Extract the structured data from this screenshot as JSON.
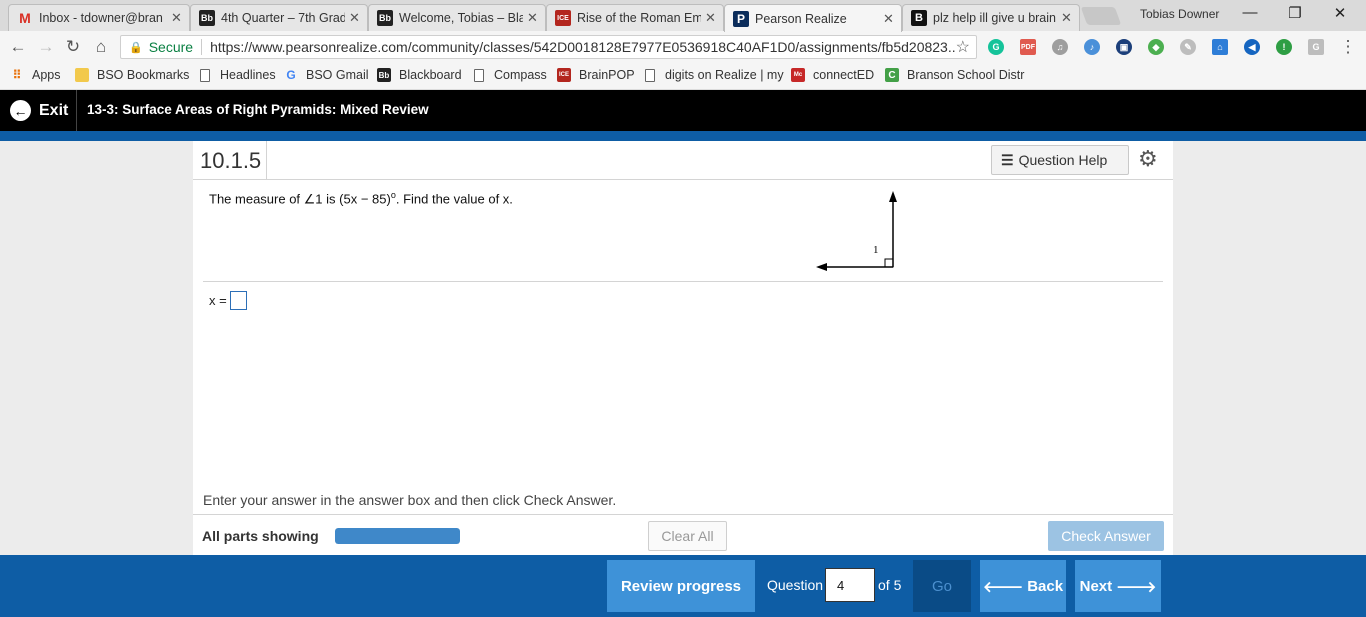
{
  "tabs": [
    {
      "title": "Inbox - tdowner@bran",
      "favicon": "M",
      "color": "#ffffff"
    },
    {
      "title": "4th Quarter – 7th Grad",
      "favicon": "Bb",
      "color": "#222222"
    },
    {
      "title": "Welcome, Tobias – Bla",
      "favicon": "Bb",
      "color": "#222222"
    },
    {
      "title": "Rise of the Roman Em",
      "favicon": "ICE",
      "color": "#b3261e"
    },
    {
      "title": "Pearson Realize",
      "favicon": "P",
      "color": "#0b2d5b"
    },
    {
      "title": "plz help ill give u brain",
      "favicon": "B",
      "color": "#111111"
    }
  ],
  "profile_name": "Tobias Downer",
  "window_controls": {
    "minimize": "—",
    "restore": "❐",
    "close": "✕"
  },
  "address": {
    "secure_label": "Secure",
    "url": "https://www.pearsonrealize.com/community/classes/542D0018128E7977E0536918C40AF1D0/assignments/fb5d20823..."
  },
  "bookmarks": [
    {
      "label": "Apps",
      "icon": "apps-grid-icon"
    },
    {
      "label": "BSO Bookmarks",
      "icon": "folder-icon"
    },
    {
      "label": "Headlines",
      "icon": "page-icon"
    },
    {
      "label": "BSO Gmail",
      "icon": "google-icon"
    },
    {
      "label": "Blackboard",
      "icon": "blackboard-icon"
    },
    {
      "label": "Compass",
      "icon": "page-icon"
    },
    {
      "label": "BrainPOP",
      "icon": "brainpop-icon"
    },
    {
      "label": "digits on Realize | my",
      "icon": "page-icon"
    },
    {
      "label": "connectED",
      "icon": "mcgraw-icon"
    },
    {
      "label": "Branson School Distr",
      "icon": "branson-icon"
    }
  ],
  "appbar": {
    "exit_label": "Exit",
    "lesson_title": "13-3: Surface Areas of Right Pyramids: Mixed Review"
  },
  "question": {
    "number": "10.1.5",
    "help_label": "Question Help",
    "text_pre": "The measure of ∠1 is (5x − 85)",
    "text_degree": "o",
    "text_post": ". Find the value of x.",
    "figure_label": "1",
    "answer_prefix": "x =",
    "hint": "Enter your answer in the answer box and then click Check Answer."
  },
  "footer": {
    "all_parts_label": "All parts showing",
    "progress": 1.0,
    "clear_all_label": "Clear All",
    "check_answer_label": "Check Answer"
  },
  "bottom_nav": {
    "review_label": "Review progress",
    "question_label": "Question",
    "current_question": "4",
    "of_label": "of 5",
    "go_label": "Go",
    "back_label": "Back",
    "next_label": "Next"
  },
  "colors": {
    "brand_blue": "#0e5da5",
    "button_blue": "#3e92d8",
    "check_answer_disabled": "#9cc3e3"
  }
}
